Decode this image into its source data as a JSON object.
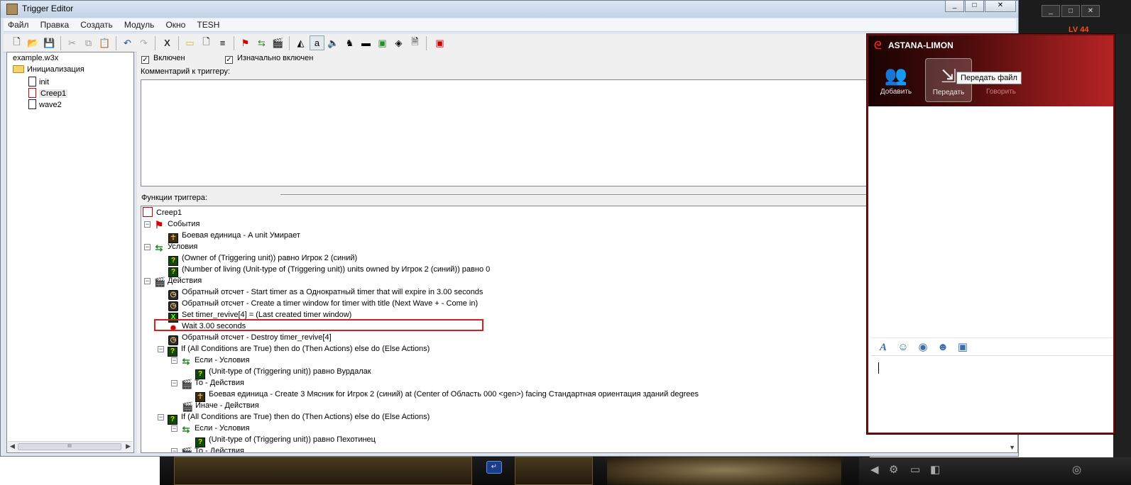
{
  "editor": {
    "title": "Trigger Editor",
    "menu": [
      "Файл",
      "Правка",
      "Создать",
      "Модуль",
      "Окно",
      "TESH"
    ],
    "tree": {
      "root": "example.w3x",
      "folder": "Инициализация",
      "items": [
        "init",
        "Creep1",
        "wave2"
      ]
    },
    "enabled_label": "Включен",
    "initially_enabled_label": "Изначально включен",
    "comment_label": "Комментарий к триггеру:",
    "functions_label": "Функции триггера:",
    "functions": {
      "trigger_name": "Creep1",
      "events_label": "События",
      "event1": "Боевая единица - A unit Умирает",
      "conditions_label": "Условия",
      "cond1": "(Owner of (Triggering unit)) равно Игрок 2 (синий)",
      "cond2": "(Number of living (Unit-type of (Triggering unit)) units owned by Игрок 2 (синий)) равно 0",
      "actions_label": "Действия",
      "act1": "Обратный отсчет - Start timer as a Однократный timer that will expire in 3.00 seconds",
      "act2": "Обратный отсчет - Create a timer window for timer with title (Next Wave +  - Come in)",
      "act3": "Set timer_revive[4] = (Last created timer window)",
      "act4": "Wait 3.00 seconds",
      "act5": "Обратный отсчет - Destroy timer_revive[4]",
      "if1": "If (All Conditions are True) then do (Then Actions) else do (Else Actions)",
      "if_cond_label": "Если - Условия",
      "if1_cond": "(Unit-type of (Triggering unit)) равно Вурдалак",
      "then_label": "То - Действия",
      "if1_then": "Боевая единица - Create 3 Мясник for Игрок 2 (синий) at (Center of Область 000 <gen>) facing Стандартная ориентация зданий degrees",
      "else_label": "Иначе - Действия",
      "if2": "If (All Conditions are True) then do (Then Actions) else do (Else Actions)",
      "if2_cond": "(Unit-type of (Triggering unit)) равно Пехотинец"
    }
  },
  "chat": {
    "app_name": "ASTANA-LIMON",
    "buttons": {
      "add": "Добавить",
      "send": "Передать",
      "talk": "Говорить"
    },
    "tooltip": "Передать файл"
  },
  "game": {
    "level": "LV 44"
  },
  "colors": {
    "highlight": "#d42020",
    "chat_accent": "#8e1a1a"
  }
}
